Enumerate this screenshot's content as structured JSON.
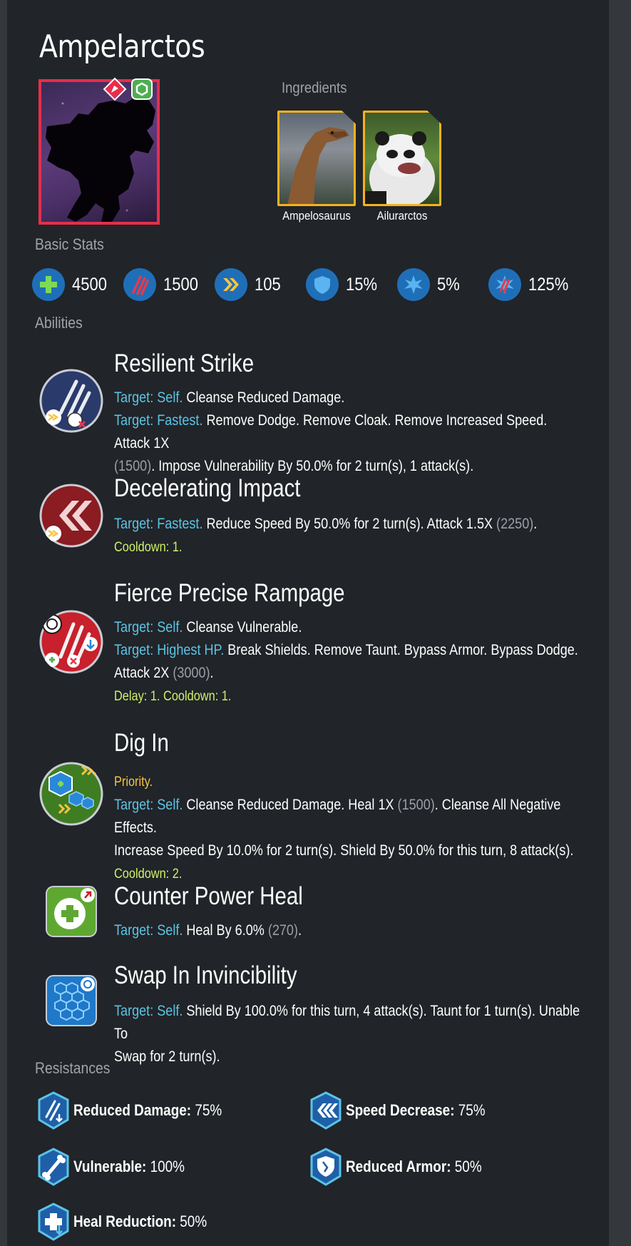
{
  "creature": {
    "name": "Ampelarctos"
  },
  "ingredients": {
    "label": "Ingredients",
    "items": [
      {
        "name": "Ampelosaurus"
      },
      {
        "name": "Ailurarctos"
      }
    ]
  },
  "basic_stats": {
    "label": "Basic Stats",
    "items": [
      {
        "icon": "health-icon",
        "value": "4500"
      },
      {
        "icon": "damage-icon",
        "value": "1500"
      },
      {
        "icon": "speed-icon",
        "value": "105"
      },
      {
        "icon": "armor-icon",
        "value": "15%"
      },
      {
        "icon": "crit-chance-icon",
        "value": "5%"
      },
      {
        "icon": "crit-damage-icon",
        "value": "125%"
      }
    ]
  },
  "abilities": {
    "label": "Abilities",
    "items": [
      {
        "name": "Resilient Strike",
        "line1_target": "Target: Self.",
        "line1_text": " Cleanse Reduced Damage.",
        "line2_target": "Target: Fastest.",
        "line2_text": " Remove Dodge. Remove Cloak. Remove Increased Speed. Attack 1X",
        "line3_num": "(1500)",
        "line3_text": ". Impose Vulnerability By 50.0% for 2 turn(s), 1 attack(s)."
      },
      {
        "name": "Decelerating Impact",
        "line1_target": "Target: Fastest.",
        "line1_text": " Reduce Speed By 50.0% for 2 turn(s). Attack 1.5X ",
        "line1_num": "(2250)",
        "line1_end": ".",
        "cooldown": "Cooldown: 1."
      },
      {
        "name": "Fierce Precise Rampage",
        "line1_target": "Target: Self.",
        "line1_text": " Cleanse Vulnerable.",
        "line2_target": "Target: Highest HP.",
        "line2_text": " Break Shields. Remove Taunt. Bypass Armor. Bypass Dodge.",
        "line3_text": "Attack 2X ",
        "line3_num": "(3000)",
        "line3_end": ".",
        "cooldown": "Delay: 1. Cooldown: 1."
      },
      {
        "name": "Dig In",
        "priority": "Priority.",
        "line1_target": "Target: Self.",
        "line1_text": " Cleanse Reduced Damage. Heal 1X ",
        "line1_num": "(1500)",
        "line1_end": ". Cleanse All Negative Effects.",
        "line2_text": "Increase Speed By 10.0% for 2 turn(s). Shield By 50.0% for this turn, 8 attack(s).",
        "cooldown": "Cooldown: 2."
      },
      {
        "name": "Counter Power Heal",
        "line1_target": "Target: Self.",
        "line1_text": " Heal By 6.0% ",
        "line1_num": "(270)",
        "line1_end": "."
      },
      {
        "name": "Swap In Invincibility",
        "line1_target": "Target: Self.",
        "line1_text": " Shield By 100.0% for this turn, 4 attack(s). Taunt for 1 turn(s). Unable To",
        "line2_text": "Swap for 2 turn(s)."
      }
    ]
  },
  "resistances": {
    "label": "Resistances",
    "items": [
      {
        "icon": "reduced-damage-icon",
        "label": "Reduced Damage:",
        "value": " 75%"
      },
      {
        "icon": "speed-decrease-icon",
        "label": "Speed Decrease:",
        "value": " 75%"
      },
      {
        "icon": "vulnerable-icon",
        "label": "Vulnerable:",
        "value": " 100%"
      },
      {
        "icon": "reduced-armor-icon",
        "label": "Reduced Armor:",
        "value": " 50%"
      },
      {
        "icon": "heal-reduction-icon",
        "label": "Heal Reduction:",
        "value": " 50%"
      }
    ]
  },
  "colors": {
    "background": "#212428",
    "target_text": "#5bc4e6",
    "cooldown_text": "#cdf06a",
    "priority_text": "#f5c542",
    "rarity_border": "#e62e4d",
    "ingredient_border": "#f5b21f",
    "stat_icon": "#1f6fb8"
  }
}
